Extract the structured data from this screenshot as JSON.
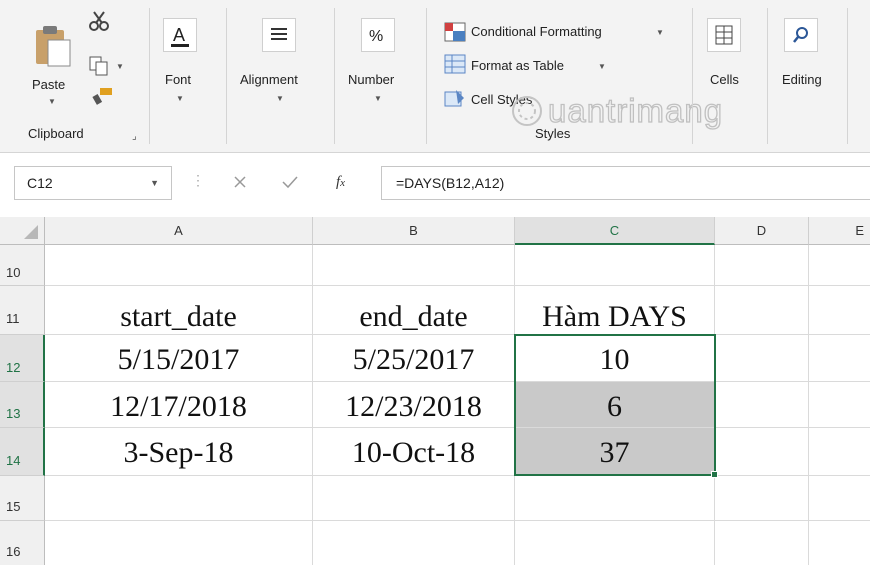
{
  "ribbon": {
    "clipboard": {
      "paste_label": "Paste",
      "group_label": "Clipboard"
    },
    "font": {
      "label": "Font"
    },
    "alignment": {
      "label": "Alignment"
    },
    "number": {
      "label": "Number"
    },
    "styles": {
      "conditional_formatting": "Conditional Formatting",
      "format_as_table": "Format as Table",
      "cell_styles": "Cell Styles",
      "group_label": "Styles"
    },
    "cells": {
      "label": "Cells"
    },
    "editing": {
      "label": "Editing"
    }
  },
  "watermark": "uantrimang",
  "formula_bar": {
    "name_box": "C12",
    "fx_symbol": "fx",
    "formula": "=DAYS(B12,A12)"
  },
  "columns": [
    "A",
    "B",
    "C",
    "D",
    "E"
  ],
  "rows": [
    {
      "num": "10",
      "a": "",
      "b": "",
      "c": ""
    },
    {
      "num": "11",
      "a": "start_date",
      "b": "end_date",
      "c": "Hàm DAYS"
    },
    {
      "num": "12",
      "a": "5/15/2017",
      "b": "5/25/2017",
      "c": "10"
    },
    {
      "num": "13",
      "a": "12/17/2018",
      "b": "12/23/2018",
      "c": "6"
    },
    {
      "num": "14",
      "a": "3-Sep-18",
      "b": "10-Oct-18",
      "c": "37"
    },
    {
      "num": "15",
      "a": "",
      "b": "",
      "c": ""
    },
    {
      "num": "16",
      "a": "",
      "b": "",
      "c": ""
    }
  ],
  "colors": {
    "accent": "#217346",
    "selection_fill": "#c9c9c9"
  }
}
